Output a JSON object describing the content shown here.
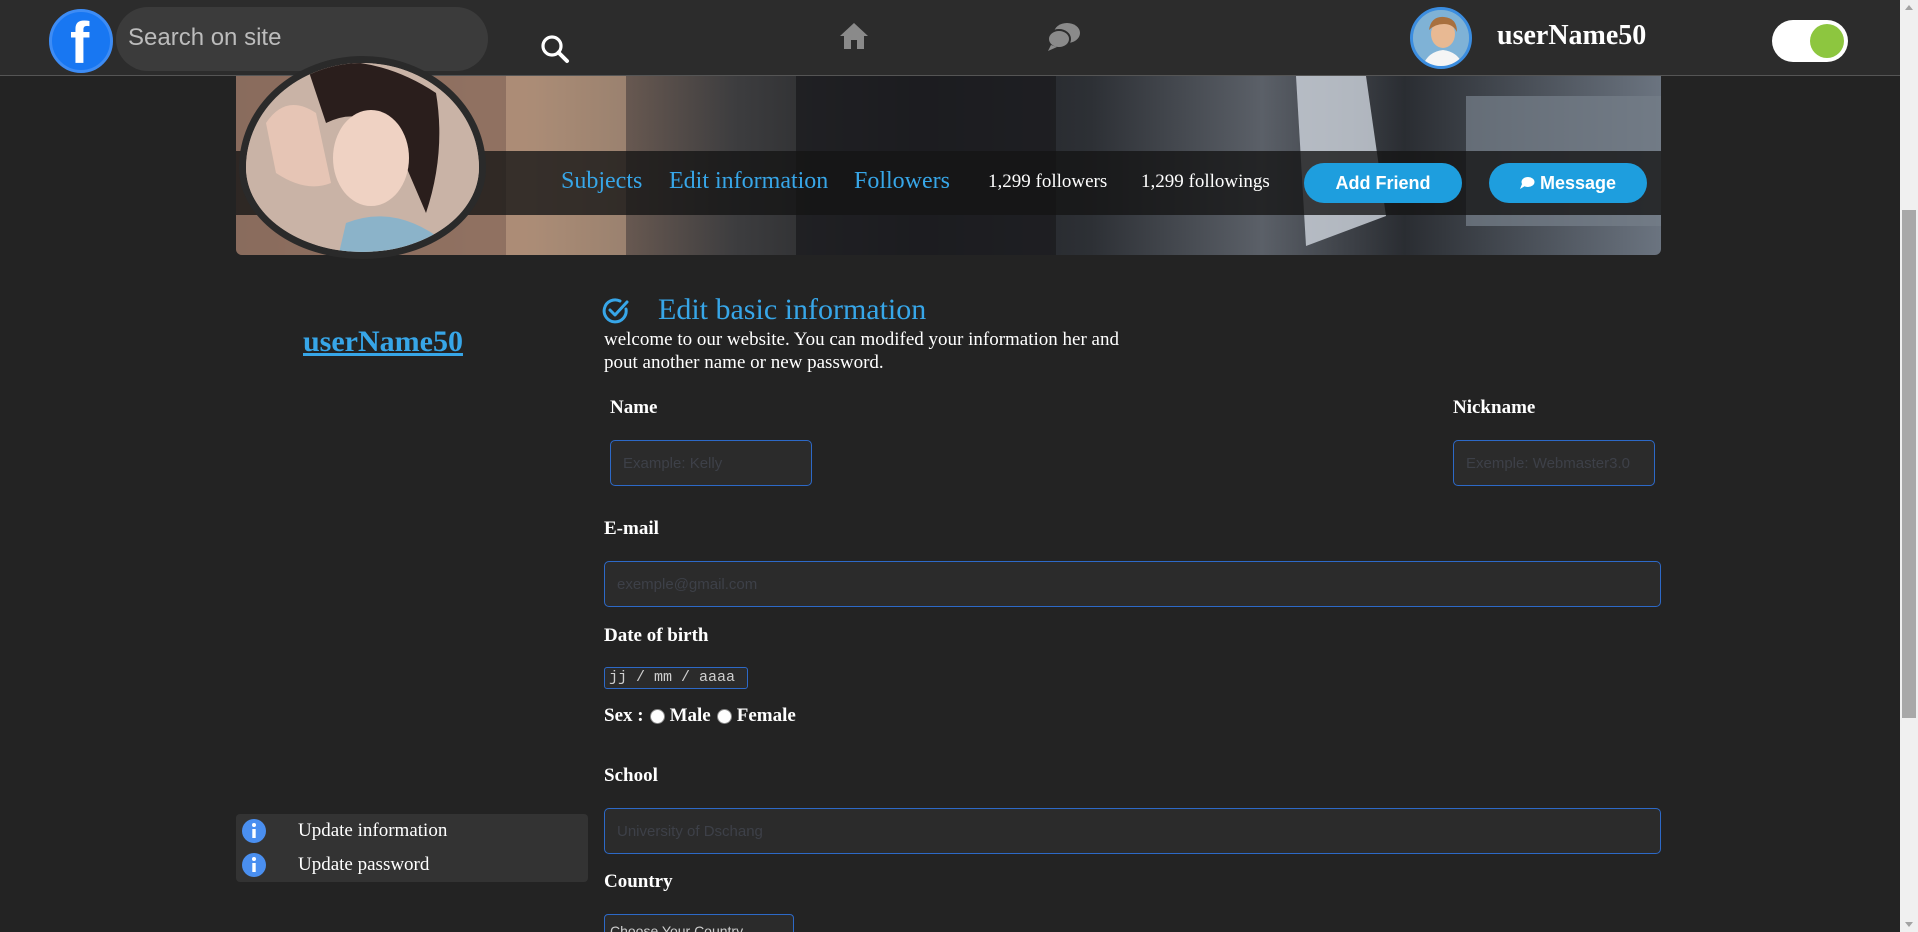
{
  "header": {
    "logo_letter": "f",
    "search_placeholder": "Search on site",
    "username": "userName50",
    "icons": [
      "facebook-logo-icon",
      "search-icon",
      "home-icon",
      "chat-icon",
      "dark-mode-toggle"
    ],
    "toggle_on": true
  },
  "profile": {
    "tabs": [
      "Subjects",
      "Edit information",
      "Followers"
    ],
    "followers": "1,299 followers",
    "followings": "1,299 followings",
    "add_friend": "Add Friend",
    "message": "Message"
  },
  "sidebar": {
    "username": "userName50",
    "items": [
      {
        "label": "Update information",
        "icon": "info-icon"
      },
      {
        "label": "Update password",
        "icon": "info-icon"
      }
    ]
  },
  "form": {
    "title": "Edit basic information",
    "intro": "welcome to our website. You can modifed your information her and pout another name or new password.",
    "name_label": "Name",
    "name_placeholder": "Example: Kelly",
    "nickname_label": "Nickname",
    "nickname_placeholder": "Exemple: Webmaster3.0",
    "email_label": "E-mail",
    "email_placeholder": "exemple@gmail.com",
    "dob_label": "Date of birth",
    "dob_value": "jj / mm / aaaa",
    "sex_label": "Sex :",
    "sex_options": [
      "Male",
      "Female"
    ],
    "school_label": "School",
    "school_placeholder": "University of Dschang",
    "country_label": "Country",
    "country_value": "Choose Your Country"
  },
  "colors": {
    "accent": "#37a6e8",
    "button": "#1e9ede",
    "background": "#232323",
    "topbar": "#2c2c2c",
    "field_border": "#2d69c7"
  }
}
